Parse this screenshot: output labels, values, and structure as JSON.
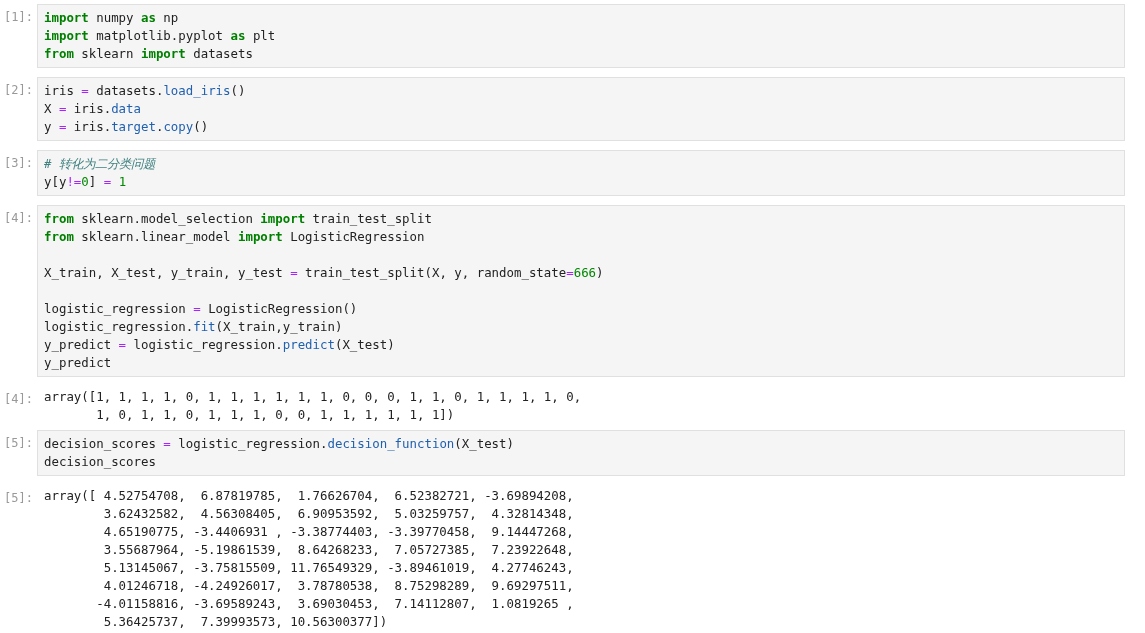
{
  "cells": [
    {
      "kind": "input",
      "prompt": "[1]:",
      "blocks": [
        [
          [
            {
              "text": "import",
              "kind": "keyword"
            },
            {
              "text": " numpy ",
              "kind": "plain"
            },
            {
              "text": "as",
              "kind": "keyword"
            },
            {
              "text": " np",
              "kind": "plain"
            }
          ],
          [
            {
              "text": "import",
              "kind": "keyword"
            },
            {
              "text": " matplotlib.pyplot ",
              "kind": "plain"
            },
            {
              "text": "as",
              "kind": "keyword"
            },
            {
              "text": " plt",
              "kind": "plain"
            }
          ],
          [
            {
              "text": "from",
              "kind": "keyword"
            },
            {
              "text": " sklearn ",
              "kind": "plain"
            },
            {
              "text": "import",
              "kind": "keyword"
            },
            {
              "text": " datasets",
              "kind": "plain"
            }
          ]
        ]
      ]
    },
    {
      "kind": "input",
      "prompt": "[2]:",
      "blocks": [
        [
          [
            {
              "text": "iris ",
              "kind": "plain"
            },
            {
              "text": "=",
              "kind": "operator"
            },
            {
              "text": " datasets.",
              "kind": "plain"
            },
            {
              "text": "load_iris",
              "kind": "attribute"
            },
            {
              "text": "()",
              "kind": "plain"
            }
          ],
          [
            {
              "text": "X ",
              "kind": "plain"
            },
            {
              "text": "=",
              "kind": "operator"
            },
            {
              "text": " iris.",
              "kind": "plain"
            },
            {
              "text": "data",
              "kind": "attribute"
            }
          ],
          [
            {
              "text": "y ",
              "kind": "plain"
            },
            {
              "text": "=",
              "kind": "operator"
            },
            {
              "text": " iris.",
              "kind": "plain"
            },
            {
              "text": "target",
              "kind": "attribute"
            },
            {
              "text": ".",
              "kind": "plain"
            },
            {
              "text": "copy",
              "kind": "attribute"
            },
            {
              "text": "()",
              "kind": "plain"
            }
          ]
        ]
      ]
    },
    {
      "kind": "input",
      "prompt": "[3]:",
      "blocks": [
        [
          [
            {
              "text": "# 转化为二分类问题",
              "kind": "comment"
            }
          ],
          [
            {
              "text": "y[y",
              "kind": "plain"
            },
            {
              "text": "!=",
              "kind": "operator"
            },
            {
              "text": "0",
              "kind": "number"
            },
            {
              "text": "] ",
              "kind": "plain"
            },
            {
              "text": "= ",
              "kind": "operator"
            },
            {
              "text": "1",
              "kind": "number"
            }
          ]
        ]
      ]
    },
    {
      "kind": "input",
      "prompt": "[4]:",
      "blocks": [
        [
          [
            {
              "text": "from",
              "kind": "keyword"
            },
            {
              "text": " sklearn.model_selection ",
              "kind": "plain"
            },
            {
              "text": "import",
              "kind": "keyword"
            },
            {
              "text": " train_test_split",
              "kind": "plain"
            }
          ],
          [
            {
              "text": "from",
              "kind": "keyword"
            },
            {
              "text": " sklearn.linear_model ",
              "kind": "plain"
            },
            {
              "text": "import",
              "kind": "keyword"
            },
            {
              "text": " LogisticRegression",
              "kind": "plain"
            }
          ]
        ],
        [
          [
            {
              "text": "X_train, X_test, y_train, y_test ",
              "kind": "plain"
            },
            {
              "text": "=",
              "kind": "operator"
            },
            {
              "text": " train_test_split(X, y, random_state",
              "kind": "plain"
            },
            {
              "text": "=",
              "kind": "operator"
            },
            {
              "text": "666",
              "kind": "number"
            },
            {
              "text": ")",
              "kind": "plain"
            }
          ]
        ],
        [
          [
            {
              "text": "logistic_regression ",
              "kind": "plain"
            },
            {
              "text": "=",
              "kind": "operator"
            },
            {
              "text": " LogisticRegression()",
              "kind": "plain"
            }
          ],
          [
            {
              "text": "logistic_regression.",
              "kind": "plain"
            },
            {
              "text": "fit",
              "kind": "attribute"
            },
            {
              "text": "(X_train,y_train)",
              "kind": "plain"
            }
          ],
          [
            {
              "text": "y_predict ",
              "kind": "plain"
            },
            {
              "text": "=",
              "kind": "operator"
            },
            {
              "text": " logistic_regression.",
              "kind": "plain"
            },
            {
              "text": "predict",
              "kind": "attribute"
            },
            {
              "text": "(X_test)",
              "kind": "plain"
            }
          ],
          [
            {
              "text": "y_predict",
              "kind": "plain"
            }
          ]
        ]
      ]
    },
    {
      "kind": "output",
      "prompt": "[4]:",
      "lines": [
        "array([1, 1, 1, 1, 0, 1, 1, 1, 1, 1, 1, 0, 0, 0, 1, 1, 0, 1, 1, 1, 1, 0,",
        "       1, 0, 1, 1, 0, 1, 1, 1, 0, 0, 1, 1, 1, 1, 1, 1])"
      ]
    },
    {
      "kind": "input",
      "prompt": "[5]:",
      "blocks": [
        [
          [
            {
              "text": "decision_scores ",
              "kind": "plain"
            },
            {
              "text": "=",
              "kind": "operator"
            },
            {
              "text": " logistic_regression.",
              "kind": "plain"
            },
            {
              "text": "decision_function",
              "kind": "attribute"
            },
            {
              "text": "(X_test)",
              "kind": "plain"
            }
          ],
          [
            {
              "text": "decision_scores",
              "kind": "plain"
            }
          ]
        ]
      ]
    },
    {
      "kind": "output",
      "prompt": "[5]:",
      "lines": [
        "array([ 4.52754708,  6.87819785,  1.76626704,  6.52382721, -3.69894208,",
        "        3.62432582,  4.56308405,  6.90953592,  5.03259757,  4.32814348,",
        "        4.65190775, -3.4406931 , -3.38774403, -3.39770458,  9.14447268,",
        "        3.55687964, -5.19861539,  8.64268233,  7.05727385,  7.23922648,",
        "        5.13145067, -3.75815509, 11.76549329, -3.89461019,  4.27746243,",
        "        4.01246718, -4.24926017,  3.78780538,  8.75298289,  9.69297511,",
        "       -4.01158816, -3.69589243,  3.69030453,  7.14112807,  1.0819265 ,",
        "        5.36425737,  7.39993573, 10.56300377])"
      ]
    }
  ]
}
